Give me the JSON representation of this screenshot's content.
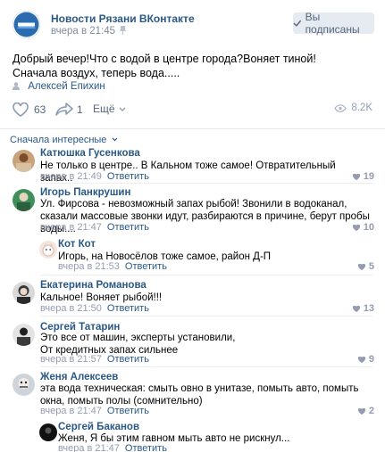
{
  "post": {
    "group_name": "Новости Рязани ВКонтакте",
    "group_avatar_text": "НОВОСТИ РЯЗАНИ",
    "time": "вчера в 21:45",
    "subscribe_label": "Вы подписаны",
    "text": "Добрый вечер!Что с водой в центре города?Воняет тиной!Сначала воздух, теперь вода.....",
    "author": "Алексей Епихин",
    "likes": "63",
    "shares": "1",
    "more_label": "Ещё",
    "views": "8.2K"
  },
  "comments_sort_label": "Сначала интересные",
  "comments": [
    {
      "name": "Катюшка Гусенкова",
      "text": "Не только в центре.. В Кальном тоже самое! Отвратительный запах..",
      "date": "вчера в 21:49",
      "reply": "Ответить",
      "likes": "19"
    },
    {
      "name": "Игорь Панкрушин",
      "text": "Ул. Фирсова - невозможный запах рыбой! Звонили в водоканал, сказали массовые звонки идут, разбираются в причине, берут пробы воды....",
      "date": "вчера в 21:47",
      "reply": "Ответить",
      "likes": "10"
    },
    {
      "name": "Кот Кот",
      "text": "Игорь, на Новосёлов тоже самое, район Д-П",
      "date": "вчера в 21:53",
      "reply": "Ответить",
      "likes": "5"
    },
    {
      "name": "Екатерина Романова",
      "text": "Кальное! Воняет рыбой!!!",
      "date": "вчера в 21:50",
      "reply": "Ответить",
      "likes": "13"
    },
    {
      "name": "Сергей Татарин",
      "text": "Это все от машин, эксперты установили,\nОт кредитных запах сильнее",
      "date": "вчера в 21:57",
      "reply": "Ответить",
      "likes": "9"
    },
    {
      "name": "Женя Алексеев",
      "text": "эта вода техническая: смыть овно в унитазе, помыть авто, помыть окна, помыть полы (сомнительно)",
      "date": "вчера в 21:47",
      "reply": "Ответить",
      "likes": "2"
    },
    {
      "name": "Сергей Баканов",
      "text": "Женя, Я бы этим гавном мыть авто не рискнул...",
      "date": "вчера в 21:47",
      "reply": "Ответить",
      "likes": ""
    }
  ]
}
